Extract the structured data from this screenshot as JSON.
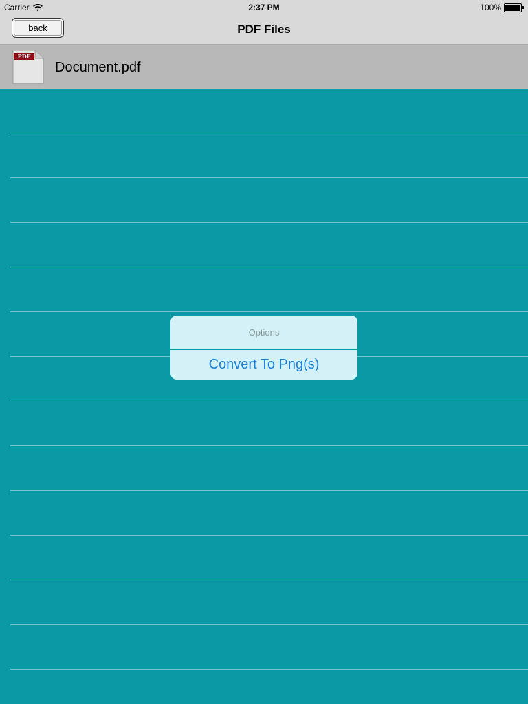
{
  "status_bar": {
    "carrier": "Carrier",
    "time": "2:37 PM",
    "battery": "100%",
    "battery_level": 1.0
  },
  "nav": {
    "back_label": "back",
    "title": "PDF Files"
  },
  "file": {
    "name": "Document.pdf",
    "icon_label": "PDF"
  },
  "popover": {
    "title": "Options",
    "action": "Convert To Png(s)"
  },
  "colors": {
    "table_background": "#0b99a5",
    "popover_background": "#d3f1f6",
    "action_text": "#1a7fd6",
    "pdf_badge": "#8b0f14"
  },
  "icons": [
    "wifi-icon",
    "battery-icon",
    "pdf-file-icon"
  ]
}
